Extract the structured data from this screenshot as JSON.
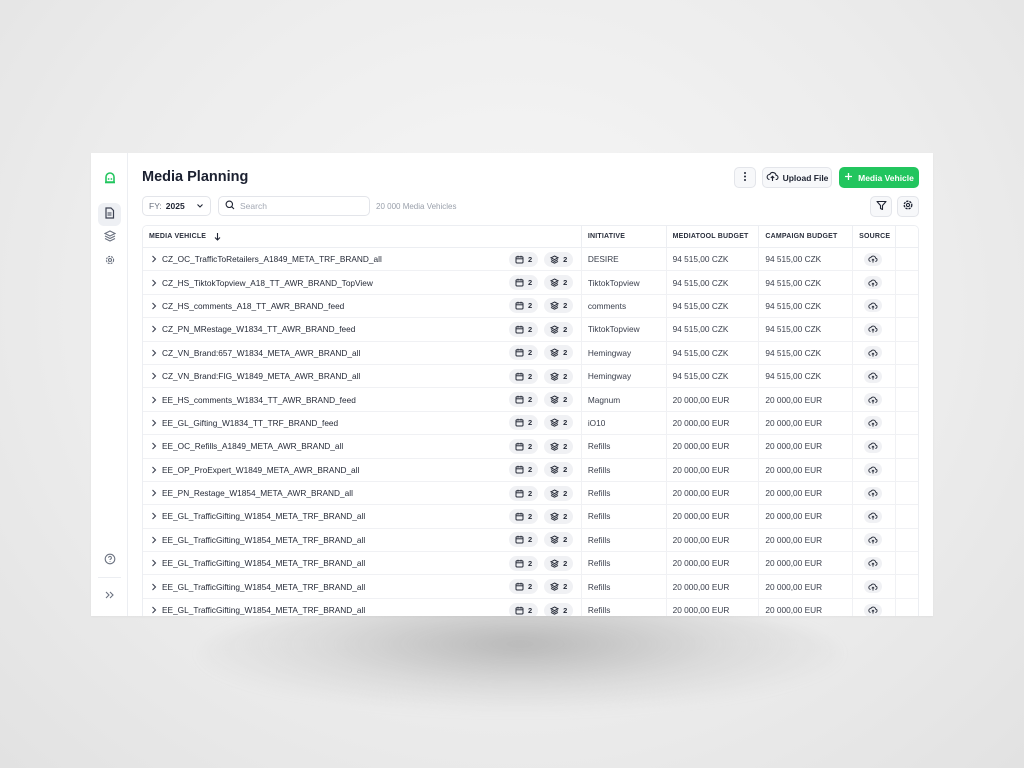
{
  "page": {
    "title": "Media Planning"
  },
  "toolbar": {
    "upload_label": "Upload File",
    "new_label": "Media Vehicle",
    "fy_label": "FY:",
    "fy_value": "2025",
    "search_placeholder": "Search",
    "count_text": "20 000 Media Vehicles"
  },
  "colors": {
    "accent": "#22c55e",
    "text": "#1f2433",
    "muted": "#9aa0ab"
  },
  "columns": {
    "media_vehicle": "MEDIA VEHICLE",
    "initiative": "INITIATIVE",
    "mediatool_budget": "MEDIATOOL BUDGET",
    "campaign_budget": "CAMPAIGN BUDGET",
    "source": "SOURCE"
  },
  "rows": [
    {
      "name": "CZ_OC_TrafficToRetailers_A1849_META_TRF_BRAND_all",
      "calendar": "2",
      "layers": "2",
      "initiative": "DESIRE",
      "mediatool_budget": "94 515,00 CZK",
      "campaign_budget": "94 515,00 CZK"
    },
    {
      "name": "CZ_HS_TiktokTopview_A18_TT_AWR_BRAND_TopView",
      "calendar": "2",
      "layers": "2",
      "initiative": "TiktokTopview",
      "mediatool_budget": "94 515,00 CZK",
      "campaign_budget": "94 515,00 CZK"
    },
    {
      "name": "CZ_HS_comments_A18_TT_AWR_BRAND_feed",
      "calendar": "2",
      "layers": "2",
      "initiative": "comments",
      "mediatool_budget": "94 515,00 CZK",
      "campaign_budget": "94 515,00 CZK"
    },
    {
      "name": "CZ_PN_MRestage_W1834_TT_AWR_BRAND_feed",
      "calendar": "2",
      "layers": "2",
      "initiative": "TiktokTopview",
      "mediatool_budget": "94 515,00 CZK",
      "campaign_budget": "94 515,00 CZK"
    },
    {
      "name": "CZ_VN_Brand:657_W1834_META_AWR_BRAND_all",
      "calendar": "2",
      "layers": "2",
      "initiative": "Hemingway",
      "mediatool_budget": "94 515,00 CZK",
      "campaign_budget": "94 515,00 CZK"
    },
    {
      "name": "CZ_VN_Brand:FIG_W1849_META_AWR_BRAND_all",
      "calendar": "2",
      "layers": "2",
      "initiative": "Hemingway",
      "mediatool_budget": "94 515,00 CZK",
      "campaign_budget": "94 515,00 CZK"
    },
    {
      "name": "EE_HS_comments_W1834_TT_AWR_BRAND_feed",
      "calendar": "2",
      "layers": "2",
      "initiative": "Magnum",
      "mediatool_budget": "20 000,00 EUR",
      "campaign_budget": "20 000,00 EUR"
    },
    {
      "name": "EE_GL_Gifting_W1834_TT_TRF_BRAND_feed",
      "calendar": "2",
      "layers": "2",
      "initiative": "iO10",
      "mediatool_budget": "20 000,00 EUR",
      "campaign_budget": "20 000,00 EUR"
    },
    {
      "name": "EE_OC_Refills_A1849_META_AWR_BRAND_all",
      "calendar": "2",
      "layers": "2",
      "initiative": "Refills",
      "mediatool_budget": "20 000,00 EUR",
      "campaign_budget": "20 000,00 EUR"
    },
    {
      "name": "EE_OP_ProExpert_W1849_META_AWR_BRAND_all",
      "calendar": "2",
      "layers": "2",
      "initiative": "Refills",
      "mediatool_budget": "20 000,00 EUR",
      "campaign_budget": "20 000,00 EUR"
    },
    {
      "name": "EE_PN_Restage_W1854_META_AWR_BRAND_all",
      "calendar": "2",
      "layers": "2",
      "initiative": "Refills",
      "mediatool_budget": "20 000,00 EUR",
      "campaign_budget": "20 000,00 EUR"
    },
    {
      "name": "EE_GL_TrafficGifting_W1854_META_TRF_BRAND_all",
      "calendar": "2",
      "layers": "2",
      "initiative": "Refills",
      "mediatool_budget": "20 000,00 EUR",
      "campaign_budget": "20 000,00 EUR"
    },
    {
      "name": "EE_GL_TrafficGifting_W1854_META_TRF_BRAND_all",
      "calendar": "2",
      "layers": "2",
      "initiative": "Refills",
      "mediatool_budget": "20 000,00 EUR",
      "campaign_budget": "20 000,00 EUR"
    },
    {
      "name": "EE_GL_TrafficGifting_W1854_META_TRF_BRAND_all",
      "calendar": "2",
      "layers": "2",
      "initiative": "Refills",
      "mediatool_budget": "20 000,00 EUR",
      "campaign_budget": "20 000,00 EUR"
    },
    {
      "name": "EE_GL_TrafficGifting_W1854_META_TRF_BRAND_all",
      "calendar": "2",
      "layers": "2",
      "initiative": "Refills",
      "mediatool_budget": "20 000,00 EUR",
      "campaign_budget": "20 000,00 EUR"
    },
    {
      "name": "EE_GL_TrafficGifting_W1854_META_TRF_BRAND_all",
      "calendar": "2",
      "layers": "2",
      "initiative": "Refills",
      "mediatool_budget": "20 000,00 EUR",
      "campaign_budget": "20 000,00 EUR"
    }
  ],
  "icons": {
    "logo": "robot-logo-icon",
    "sidebar": [
      "document-icon",
      "layers-icon",
      "gear-icon",
      "help-icon",
      "expand-icon"
    ],
    "toolbar": [
      "more-vertical-icon",
      "cloud-upload-icon",
      "plus-icon",
      "chevron-down-icon",
      "search-icon",
      "filter-icon",
      "gear-icon"
    ]
  }
}
